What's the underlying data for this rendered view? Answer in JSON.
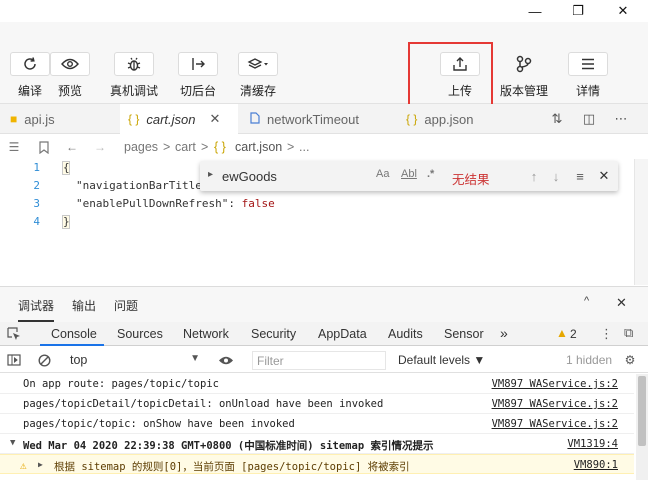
{
  "window": {
    "minimize": "—",
    "maximize": "❐",
    "close": "✕"
  },
  "toolbar": {
    "items": [
      {
        "label": "编译",
        "icon": "refresh-icon"
      },
      {
        "label": "预览",
        "icon": "eye-icon"
      },
      {
        "label": "真机调试",
        "icon": "bug-icon"
      },
      {
        "label": "切后台",
        "icon": "switch-icon"
      },
      {
        "label": "清缓存",
        "icon": "layers-icon"
      },
      {
        "label": "上传",
        "icon": "upload-icon"
      },
      {
        "label": "版本管理",
        "icon": "branch-icon"
      },
      {
        "label": "详情",
        "icon": "menu-icon"
      }
    ],
    "highlight_color": "#e53935"
  },
  "tabs": [
    {
      "label": "api.js",
      "icon": "js-file-icon"
    },
    {
      "label": "cart.json",
      "icon": "json-file-icon",
      "active": true
    },
    {
      "label": "networkTimeout",
      "icon": "file-icon"
    },
    {
      "label": "app.json",
      "icon": "json-file-icon"
    }
  ],
  "breadcrumb": {
    "parts": [
      "pages",
      ">",
      "cart",
      ">",
      "{ }",
      "cart.json",
      ">",
      "..."
    ]
  },
  "code": {
    "line_numbers": [
      "1",
      "2",
      "3",
      "4"
    ],
    "line2": "\"navigationBarTitle",
    "line3_key": "\"enablePullDownRefresh\": ",
    "line3_value": "false",
    "brace_open": "{",
    "brace_close": "}"
  },
  "find": {
    "query": "ewGoods",
    "opt_case": "Aa",
    "opt_word": "Abl",
    "opt_regex": ".*",
    "result": "无结果"
  },
  "panel": {
    "tabs": [
      "调试器",
      "输出",
      "问题"
    ]
  },
  "devtools": {
    "tabs": [
      "Console",
      "Sources",
      "Network",
      "Security",
      "AppData",
      "Audits",
      "Sensor"
    ],
    "more": "»",
    "warnings": "2"
  },
  "console": {
    "context": "top",
    "filter_placeholder": "Filter",
    "levels": "Default levels ▼",
    "hidden": "1 hidden",
    "logs": [
      {
        "msg": "On app route: pages/topic/topic",
        "src": "VM897 WAService.js:2"
      },
      {
        "msg": "pages/topicDetail/topicDetail: onUnload have been invoked",
        "src": "VM897 WAService.js:2"
      },
      {
        "msg": "pages/topic/topic: onShow have been invoked",
        "src": "VM897 WAService.js:2"
      },
      {
        "msg": "Wed Mar 04 2020 22:39:38 GMT+0800 (中国标准时间) sitemap 索引情况提示",
        "src": "VM1319:4"
      },
      {
        "msg": "根据 sitemap 的规则[0]，当前页面 [pages/topic/topic] 将被索引",
        "src": "VM890:1"
      }
    ]
  }
}
